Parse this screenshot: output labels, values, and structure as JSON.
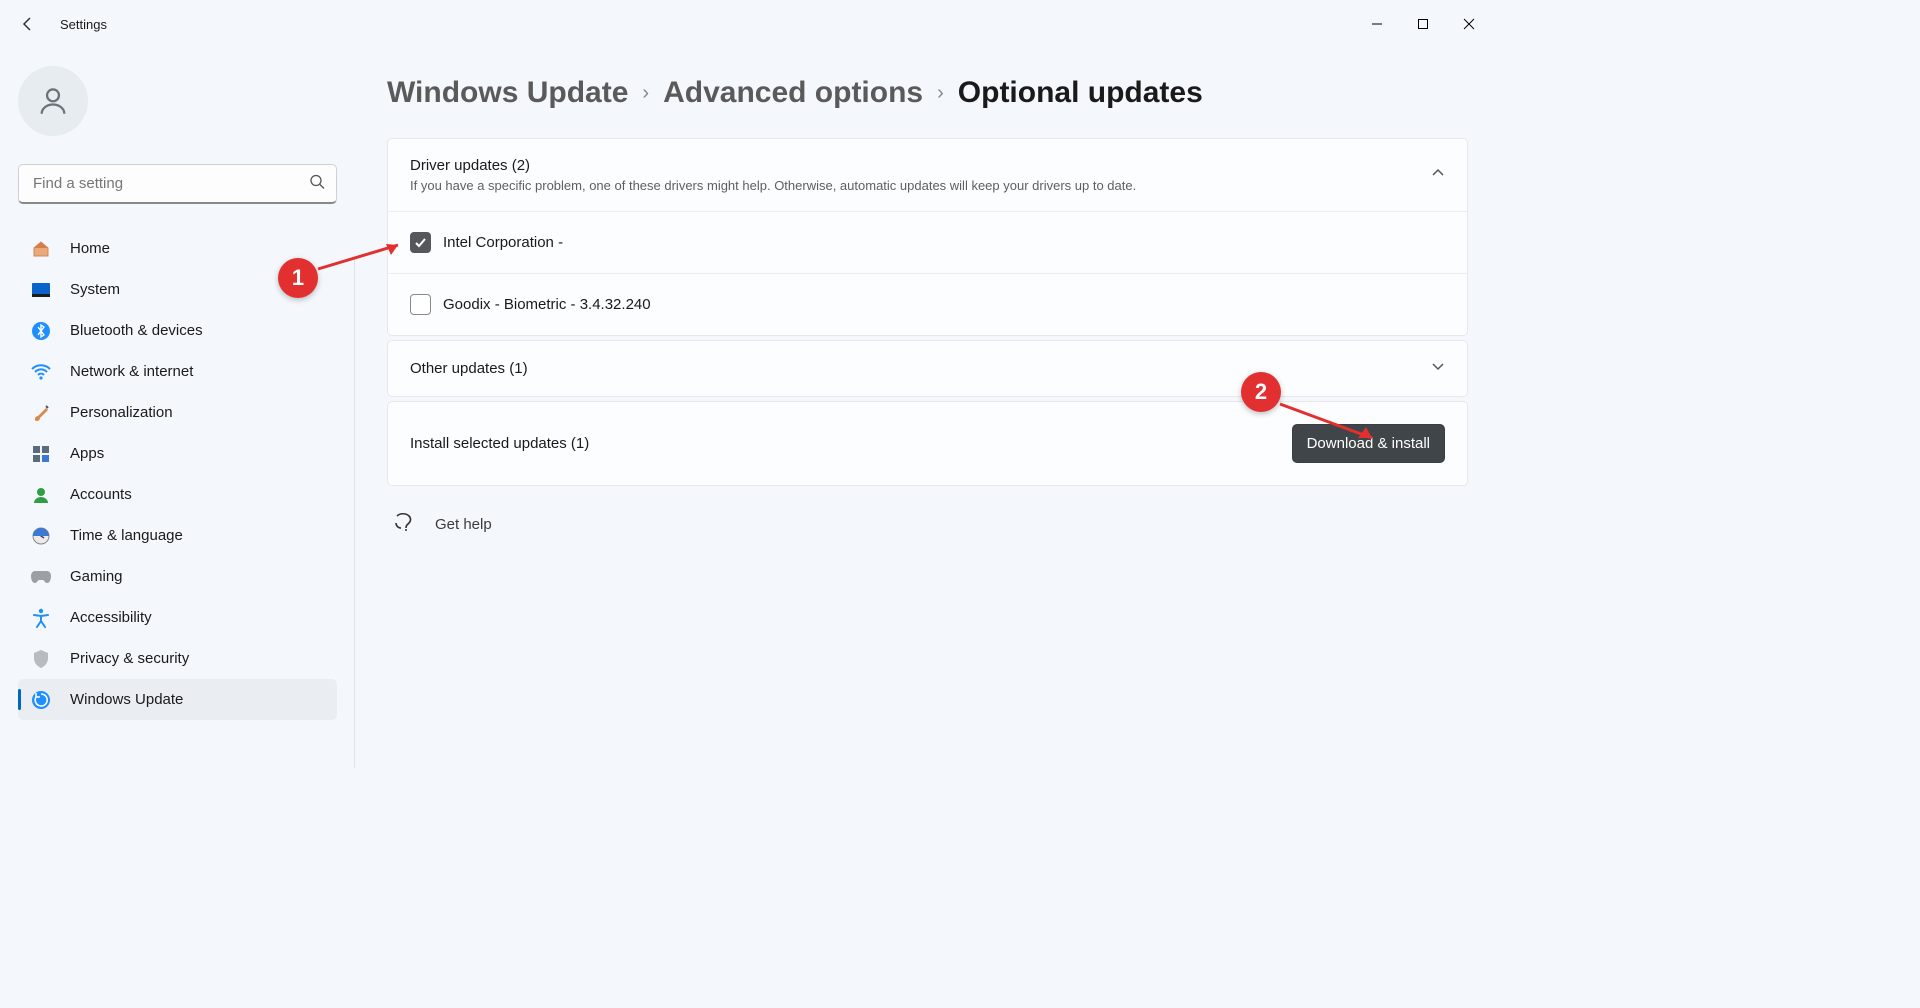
{
  "window": {
    "title": "Settings"
  },
  "search": {
    "placeholder": "Find a setting"
  },
  "sidebar": {
    "items": [
      {
        "label": "Home"
      },
      {
        "label": "System"
      },
      {
        "label": "Bluetooth & devices"
      },
      {
        "label": "Network & internet"
      },
      {
        "label": "Personalization"
      },
      {
        "label": "Apps"
      },
      {
        "label": "Accounts"
      },
      {
        "label": "Time & language"
      },
      {
        "label": "Gaming"
      },
      {
        "label": "Accessibility"
      },
      {
        "label": "Privacy & security"
      },
      {
        "label": "Windows Update"
      }
    ],
    "active_index": 11
  },
  "breadcrumb": {
    "a": "Windows Update",
    "b": "Advanced options",
    "c": "Optional updates"
  },
  "driver_section": {
    "title": "Driver updates (2)",
    "subtitle": "If you have a specific problem, one of these drivers might help. Otherwise, automatic updates will keep your drivers up to date.",
    "items": [
      {
        "label": "Intel Corporation -",
        "checked": true
      },
      {
        "label": "Goodix - Biometric - 3.4.32.240",
        "checked": false
      }
    ]
  },
  "other_section": {
    "title": "Other updates (1)"
  },
  "install_section": {
    "title": "Install selected updates (1)",
    "button": "Download & install"
  },
  "help": {
    "label": "Get help"
  },
  "annotations": {
    "one": "1",
    "two": "2"
  }
}
